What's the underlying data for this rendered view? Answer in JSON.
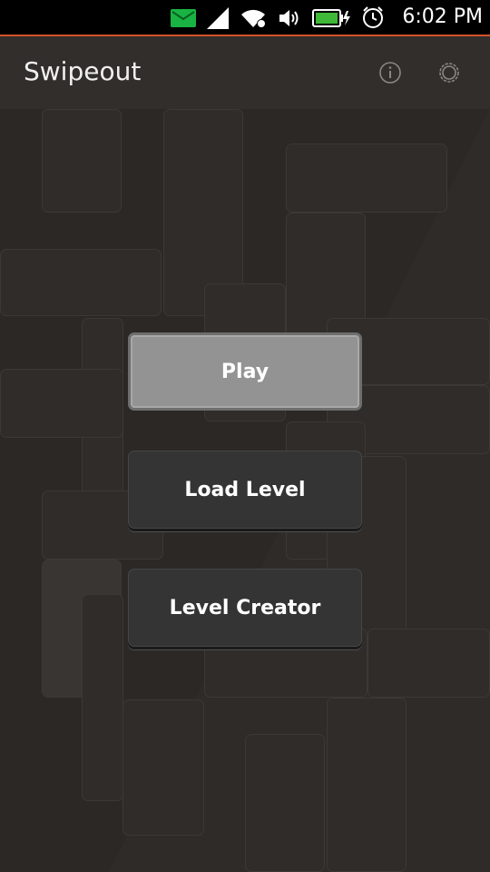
{
  "status_bar": {
    "time": "6:02 PM",
    "icons": [
      "message-icon",
      "signal-icon",
      "wifi-icon",
      "volume-icon",
      "battery-icon",
      "alarm-icon"
    ],
    "accent_color": "#d4532a",
    "message_icon_color": "#19b343",
    "battery_color": "#3fb838"
  },
  "header": {
    "title": "Swipeout",
    "icons": [
      "info-icon",
      "settings-icon"
    ]
  },
  "menu": {
    "play_label": "Play",
    "load_level_label": "Load Level",
    "level_creator_label": "Level Creator"
  },
  "colors": {
    "background": "#2b2826",
    "header_background": "#312e2c",
    "primary_button": "#939393",
    "secondary_button": "#343434"
  }
}
